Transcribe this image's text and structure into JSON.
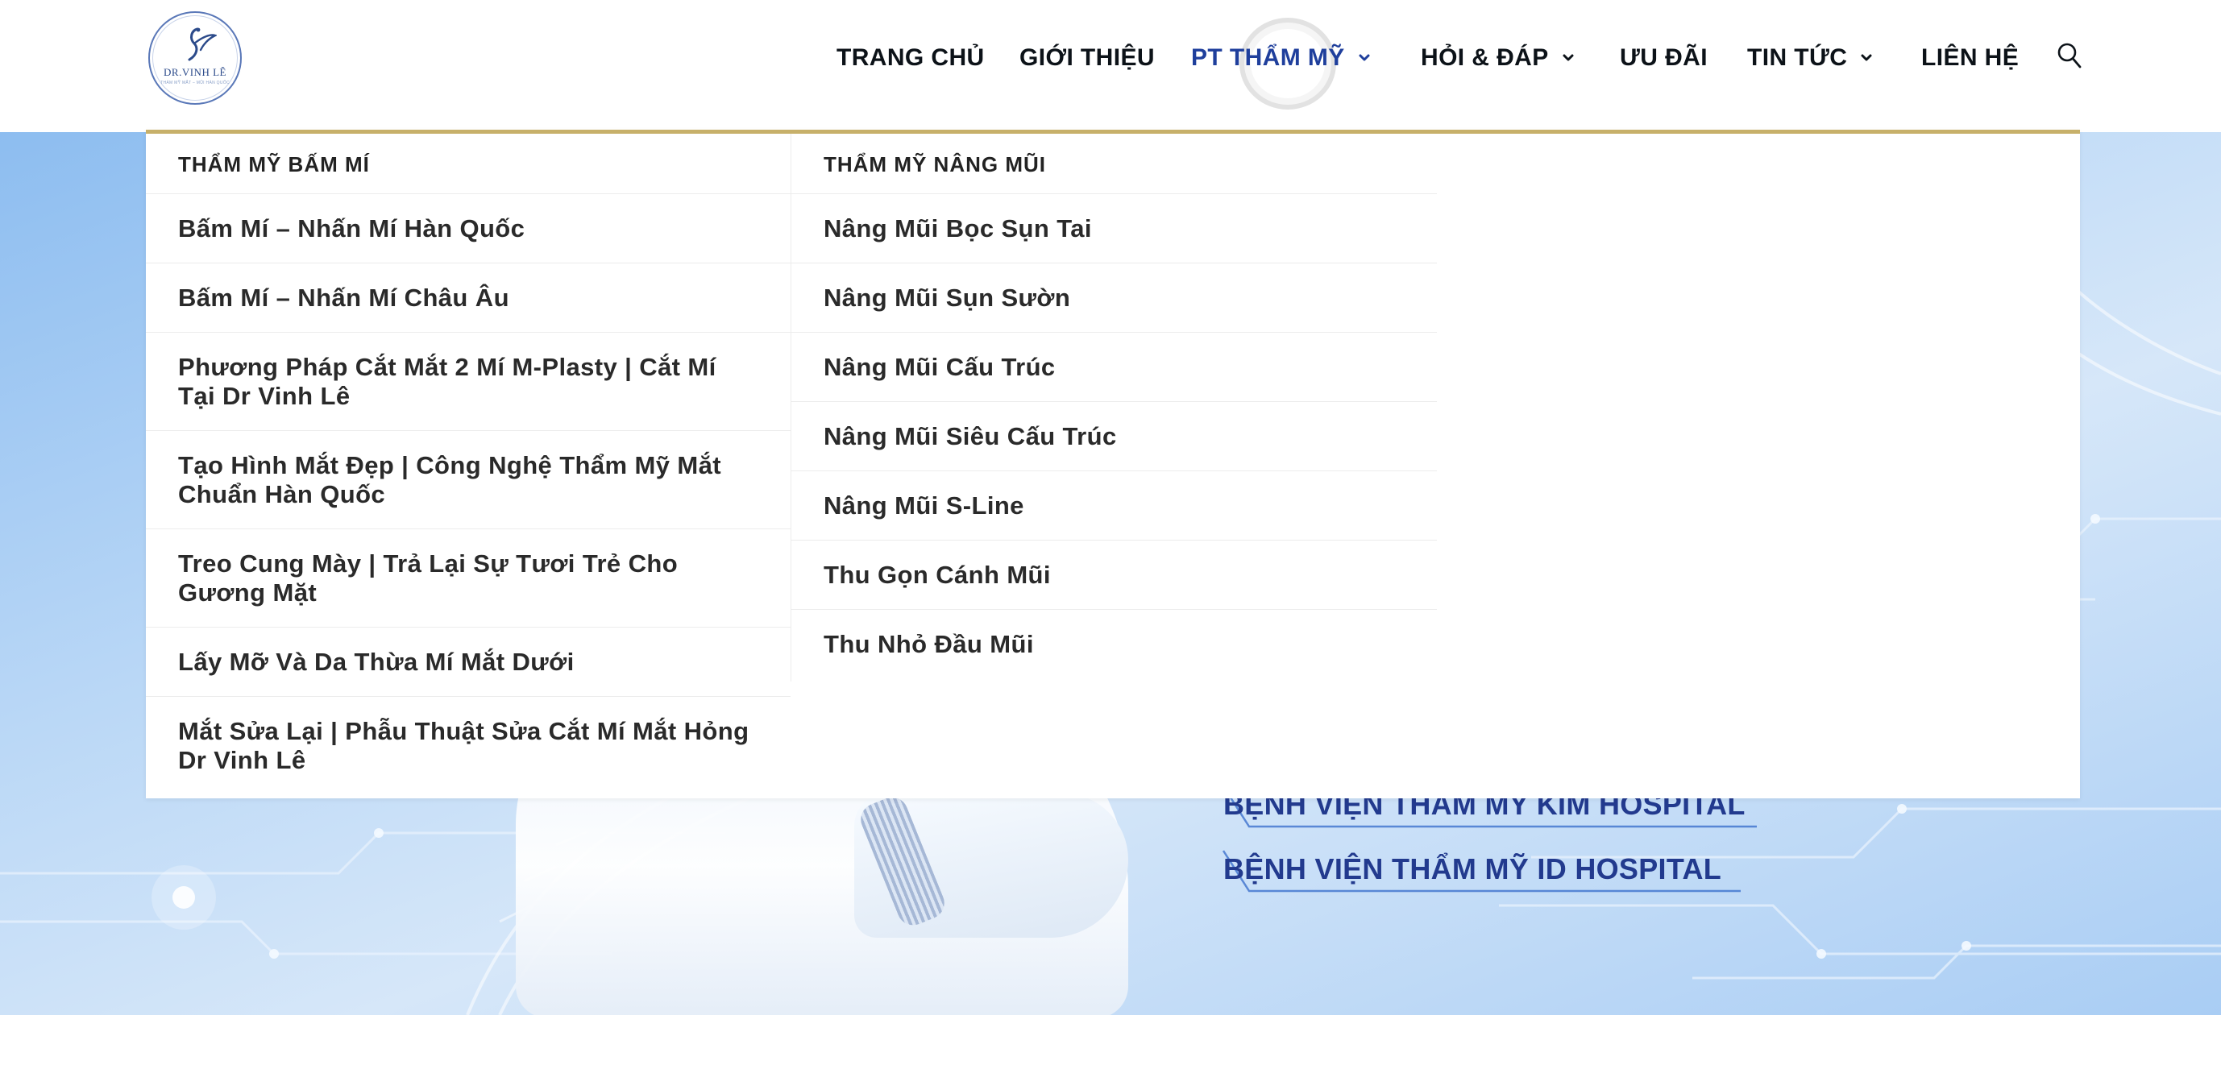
{
  "header": {
    "logo": {
      "text": "DR.VINH LÊ",
      "sub": "THẨM MỸ MẮT – MŨI HÀN QUỐC"
    },
    "nav": [
      {
        "label": "TRANG CHỦ",
        "has_dropdown": false
      },
      {
        "label": "GIỚI THIỆU",
        "has_dropdown": false
      },
      {
        "label": "PT THẨM MỸ",
        "has_dropdown": true,
        "active": true
      },
      {
        "label": "HỎI & ĐÁP",
        "has_dropdown": true
      },
      {
        "label": "ƯU ĐÃI",
        "has_dropdown": false
      },
      {
        "label": "TIN TỨC",
        "has_dropdown": true
      },
      {
        "label": "LIÊN HỆ",
        "has_dropdown": false
      }
    ],
    "search_icon": "search-icon"
  },
  "dropdown": {
    "columns": [
      {
        "heading": "THẨM MỸ BẤM MÍ",
        "items": [
          "Bấm Mí – Nhấn Mí Hàn Quốc",
          "Bấm Mí – Nhấn Mí Châu Âu",
          "Phương Pháp Cắt Mắt 2 Mí M-Plasty | Cắt Mí Tại Dr Vinh Lê",
          "Tạo Hình Mắt Đẹp | Công Nghệ Thẩm Mỹ Mắt Chuẩn Hàn Quốc",
          "Treo Cung Mày | Trả Lại Sự Tươi Trẻ Cho Gương Mặt",
          "Lấy Mỡ Và Da Thừa Mí Mắt Dưới",
          "Mắt Sửa Lại | Phẫu Thuật Sửa Cắt Mí Mắt Hỏng Dr Vinh Lê"
        ]
      },
      {
        "heading": "THẨM MỸ NÂNG MŨI",
        "items": [
          "Nâng Mũi Bọc Sụn Tai",
          "Nâng Mũi Sụn Sườn",
          "Nâng Mũi Cấu Trúc",
          "Nâng Mũi Siêu Cấu Trúc",
          "Nâng Mũi S-Line",
          "Thu Gọn Cánh Mũi",
          "Thu Nhỏ Đầu Mũi"
        ]
      }
    ]
  },
  "hero": {
    "hospitals": [
      "BỆNH VIỆN THAM MY KIM HOSPITAL",
      "BỆNH VIỆN THẨM MỸ ID HOSPITAL"
    ]
  },
  "colors": {
    "accent_border": "#c7b06a",
    "nav_active": "#1f3f9c",
    "hospital_text": "#223a8e"
  }
}
